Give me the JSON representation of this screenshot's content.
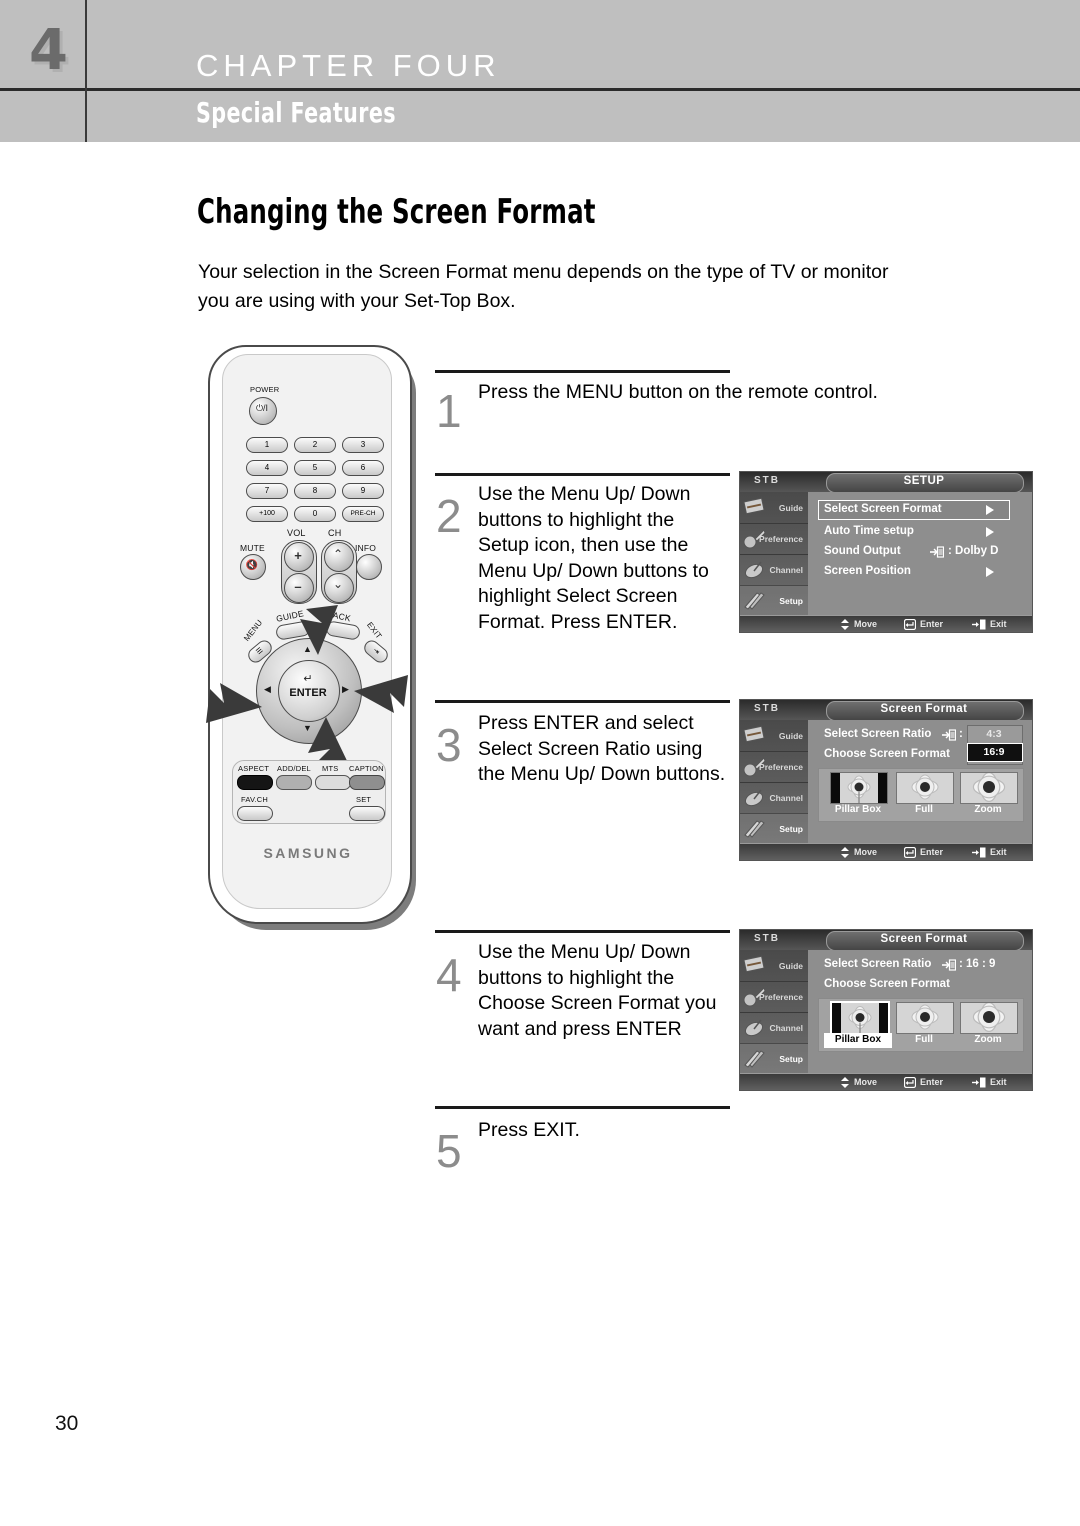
{
  "header": {
    "chapter_number": "4",
    "chapter_title": "CHAPTER FOUR",
    "chapter_subtitle": "Special Features"
  },
  "page": {
    "title": "Changing the Screen Format",
    "intro": "Your selection in the Screen Format menu depends on the type of TV or monitor you are using with your Set-Top Box.",
    "page_number": "30"
  },
  "remote": {
    "brand": "SAMSUNG",
    "power_label": "POWER",
    "power_glyph": "⏻/I",
    "keypad": [
      "1",
      "2",
      "3",
      "4",
      "5",
      "6",
      "7",
      "8",
      "9",
      "+100",
      "0",
      "PRE-CH"
    ],
    "vol_label": "VOL",
    "ch_label": "CH",
    "mute_label": "MUTE",
    "info_label": "INFO",
    "vol_up": "+",
    "vol_down": "–",
    "ch_up": "⌃",
    "ch_down": "⌄",
    "guide_label": "GUIDE",
    "back_label": "BACK",
    "menu_label": "MENU",
    "exit_label": "EXIT",
    "enter_label": "ENTER",
    "dpad_up": "▲",
    "dpad_down": "▼",
    "dpad_left": "◀",
    "dpad_right": "▶",
    "function_buttons": [
      "ASPECT",
      "ADD/DEL",
      "MTS",
      "CAPTION"
    ],
    "function_buttons_row2": [
      "FAV.CH",
      "SET"
    ]
  },
  "steps": [
    {
      "number": "1",
      "text": "Press the MENU button on the remote control."
    },
    {
      "number": "2",
      "text": "Use the Menu Up/ Down buttons to highlight the Setup icon, then use the Menu Up/ Down buttons to highlight Select Screen Format. Press ENTER."
    },
    {
      "number": "3",
      "text": "Press ENTER and select Select Screen Ratio using the Menu Up/ Down buttons."
    },
    {
      "number": "4",
      "text": "Use the Menu Up/ Down buttons to highlight the Choose Screen Format you want and press ENTER"
    },
    {
      "number": "5",
      "text": "Press EXIT."
    }
  ],
  "osd_common": {
    "stb_label": "STB",
    "sidebar": [
      {
        "label": "Guide",
        "icon": "program-guide-icon"
      },
      {
        "label": "Preference",
        "icon": "wrench-gauge-icon"
      },
      {
        "label": "Channel",
        "icon": "satellite-dish-icon"
      },
      {
        "label": "Setup",
        "icon": "tools-icon"
      }
    ],
    "active_sidebar": "Setup",
    "footer": [
      {
        "label": "Move",
        "icon": "up-down-arrows-icon"
      },
      {
        "label": "Enter",
        "icon": "enter-key-icon"
      },
      {
        "label": "Exit",
        "icon": "exit-door-icon"
      }
    ]
  },
  "osd_setup": {
    "title": "SETUP",
    "items": [
      {
        "label": "Select Screen Format",
        "value": "",
        "has_arrow": true,
        "highlighted": true
      },
      {
        "label": "Auto Time setup",
        "value": "",
        "has_arrow": true,
        "highlighted": false
      },
      {
        "label": "Sound Output",
        "value": ": Dolby D",
        "has_arrow": false,
        "highlighted": false
      },
      {
        "label": "Screen Position",
        "value": "",
        "has_arrow": true,
        "highlighted": false
      }
    ]
  },
  "osd_format_ratio": {
    "title": "Screen Format",
    "row1_label": "Select  Screen Ratio",
    "row1_suffix": ":",
    "row2_label": "Choose Screen Format",
    "ratio_options": [
      "4:3",
      "16:9"
    ],
    "ratio_selected": "16:9",
    "thumbnails": [
      {
        "label": "Pillar Box",
        "selected": false
      },
      {
        "label": "Full",
        "selected": false
      },
      {
        "label": "Zoom",
        "selected": false
      }
    ]
  },
  "osd_format_choose": {
    "title": "Screen Format",
    "row1_label": "Select  Screen Ratio",
    "row1_value": ": 16 : 9",
    "row2_label": "Choose Screen Format",
    "thumbnails": [
      {
        "label": "Pillar Box",
        "selected": true
      },
      {
        "label": "Full",
        "selected": false
      },
      {
        "label": "Zoom",
        "selected": false
      }
    ]
  }
}
